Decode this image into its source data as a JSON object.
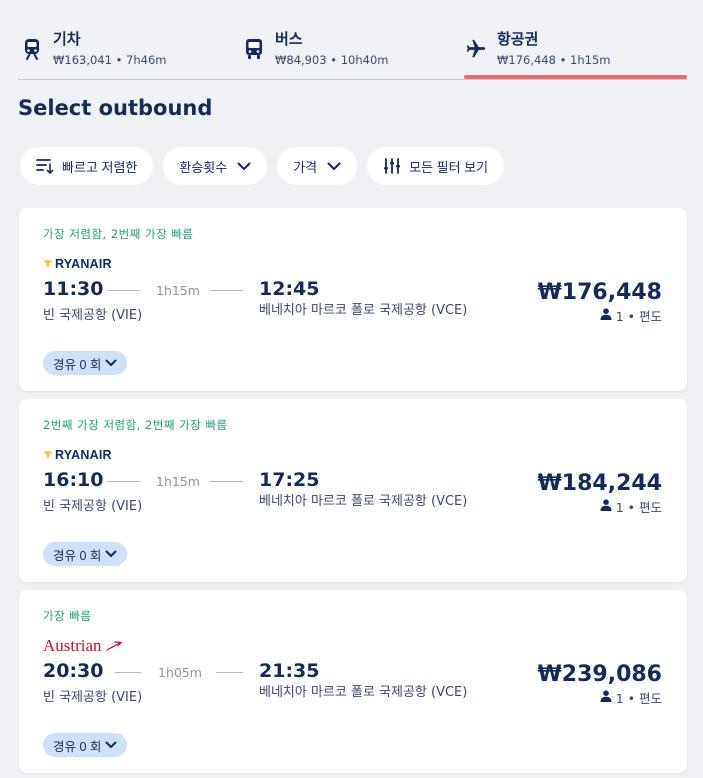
{
  "tabs": [
    {
      "icon": "train-icon",
      "name": "기차",
      "sub": "₩163,041 • 7h46m",
      "active": false
    },
    {
      "icon": "bus-icon",
      "name": "버스",
      "sub": "₩84,903 • 10h40m",
      "active": false
    },
    {
      "icon": "plane-icon",
      "name": "항공권",
      "sub": "₩176,448 • 1h15m",
      "active": true
    }
  ],
  "heading": "Select outbound",
  "filters": {
    "sort": "빠르고 저렴한",
    "transfers": "환승횟수",
    "price": "가격",
    "all_filters": "모든 필터 보기"
  },
  "flights": [
    {
      "badge": "가장 저렴함, 2번째 가장 빠름",
      "airline": "RYANAIR",
      "dep_time": "11:30",
      "duration": "1h15m",
      "arr_time": "12:45",
      "dep_airport": "빈 국제공항 (VIE)",
      "arr_airport": "베네치아 마르코 폴로 국제공항 (VCE)",
      "price": "₩176,448",
      "pax": "1 • 편도",
      "stops": "경유 0 회"
    },
    {
      "badge": "2번째 가장 저렴함, 2번째 가장 빠름",
      "airline": "RYANAIR",
      "dep_time": "16:10",
      "duration": "1h15m",
      "arr_time": "17:25",
      "dep_airport": "빈 국제공항 (VIE)",
      "arr_airport": "베네치아 마르코 폴로 국제공항 (VCE)",
      "price": "₩184,244",
      "pax": "1 • 편도",
      "stops": "경유 0 회"
    },
    {
      "badge": "가장 빠름",
      "airline": "Austrian",
      "dep_time": "20:30",
      "duration": "1h05m",
      "arr_time": "21:35",
      "dep_airport": "빈 국제공항 (VIE)",
      "arr_airport": "베네치아 마르코 폴로 국제공항 (VCE)",
      "price": "₩239,086",
      "pax": "1 • 편도",
      "stops": "경유 0 회"
    }
  ],
  "colors": {
    "primary_text": "#142a5a",
    "badge_green": "#21a07a",
    "active_tab_bar": "#ea6b6b",
    "stops_pill": "#cfe1f6",
    "austrian_red": "#c8102e",
    "ryanair_navy": "#0e2a6b"
  }
}
